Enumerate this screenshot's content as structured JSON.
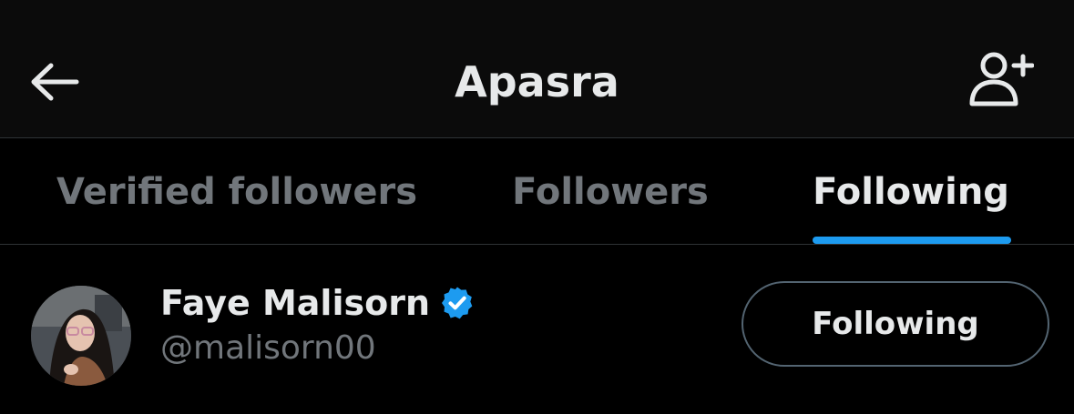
{
  "header": {
    "title": "Apasra",
    "back_icon": "arrow-left-icon",
    "action_icon": "add-user-icon"
  },
  "tabs": [
    {
      "label": "Verified followers",
      "active": false
    },
    {
      "label": "Followers",
      "active": false
    },
    {
      "label": "Following",
      "active": true
    }
  ],
  "users": [
    {
      "display_name": "Faye Malisorn",
      "handle": "@malisorn00",
      "verified": true,
      "button_label": "Following"
    }
  ],
  "colors": {
    "accent": "#1d9bf0",
    "background": "#000000",
    "header_background": "#0b0b0b",
    "text_primary": "#e7e9ea",
    "text_secondary": "#71767b",
    "border": "#2f3336"
  }
}
